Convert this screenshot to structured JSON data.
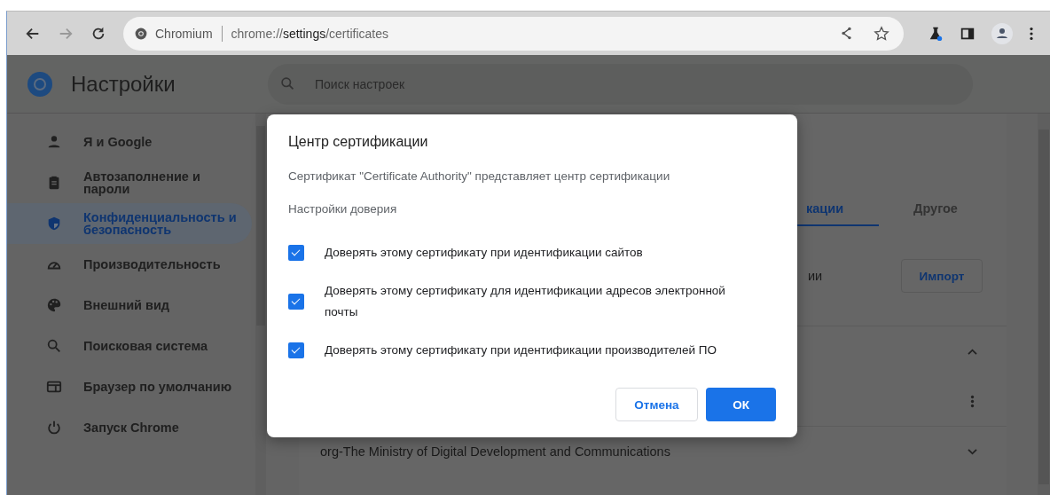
{
  "toolbar": {
    "site_label": "Chromium",
    "url": "chrome://**settings**/certificates"
  },
  "header": {
    "title": "Настройки",
    "search": {
      "placeholder": "Поиск настроек"
    }
  },
  "sidebar": {
    "items": [
      {
        "label": "Я и Google",
        "selected": false
      },
      {
        "label": "Автозаполнение и пароли",
        "selected": false
      },
      {
        "label": "Конфиденциальность и безопасность",
        "selected": true
      },
      {
        "label": "Производительность",
        "selected": false
      },
      {
        "label": "Внешний вид",
        "selected": false
      },
      {
        "label": "Поисковая система",
        "selected": false
      },
      {
        "label": "Браузер по умолчанию",
        "selected": false
      },
      {
        "label": "Запуск Chrome",
        "selected": false
      }
    ]
  },
  "content": {
    "tabs": [
      {
        "label": "кации",
        "selected": true
      },
      {
        "label": "Другое",
        "selected": false
      }
    ],
    "row_text": "ии",
    "import_button": "Импорт",
    "org_row": "org-The Ministry of Digital Development and Communications"
  },
  "dialog": {
    "title": "Центр сертификации",
    "description": "Сертификат \"Certificate Authority\" представляет центр сертификации",
    "section_label": "Настройки доверия",
    "options": [
      {
        "label": "Доверять этому сертификату при идентификации сайтов",
        "checked": true
      },
      {
        "label": "Доверять этому сертификату для идентификации адресов электронной почты",
        "checked": true
      },
      {
        "label": "Доверять этому сертификату при идентификации производителей ПО",
        "checked": true
      }
    ],
    "cancel": "Отмена",
    "ok": "ОК"
  }
}
